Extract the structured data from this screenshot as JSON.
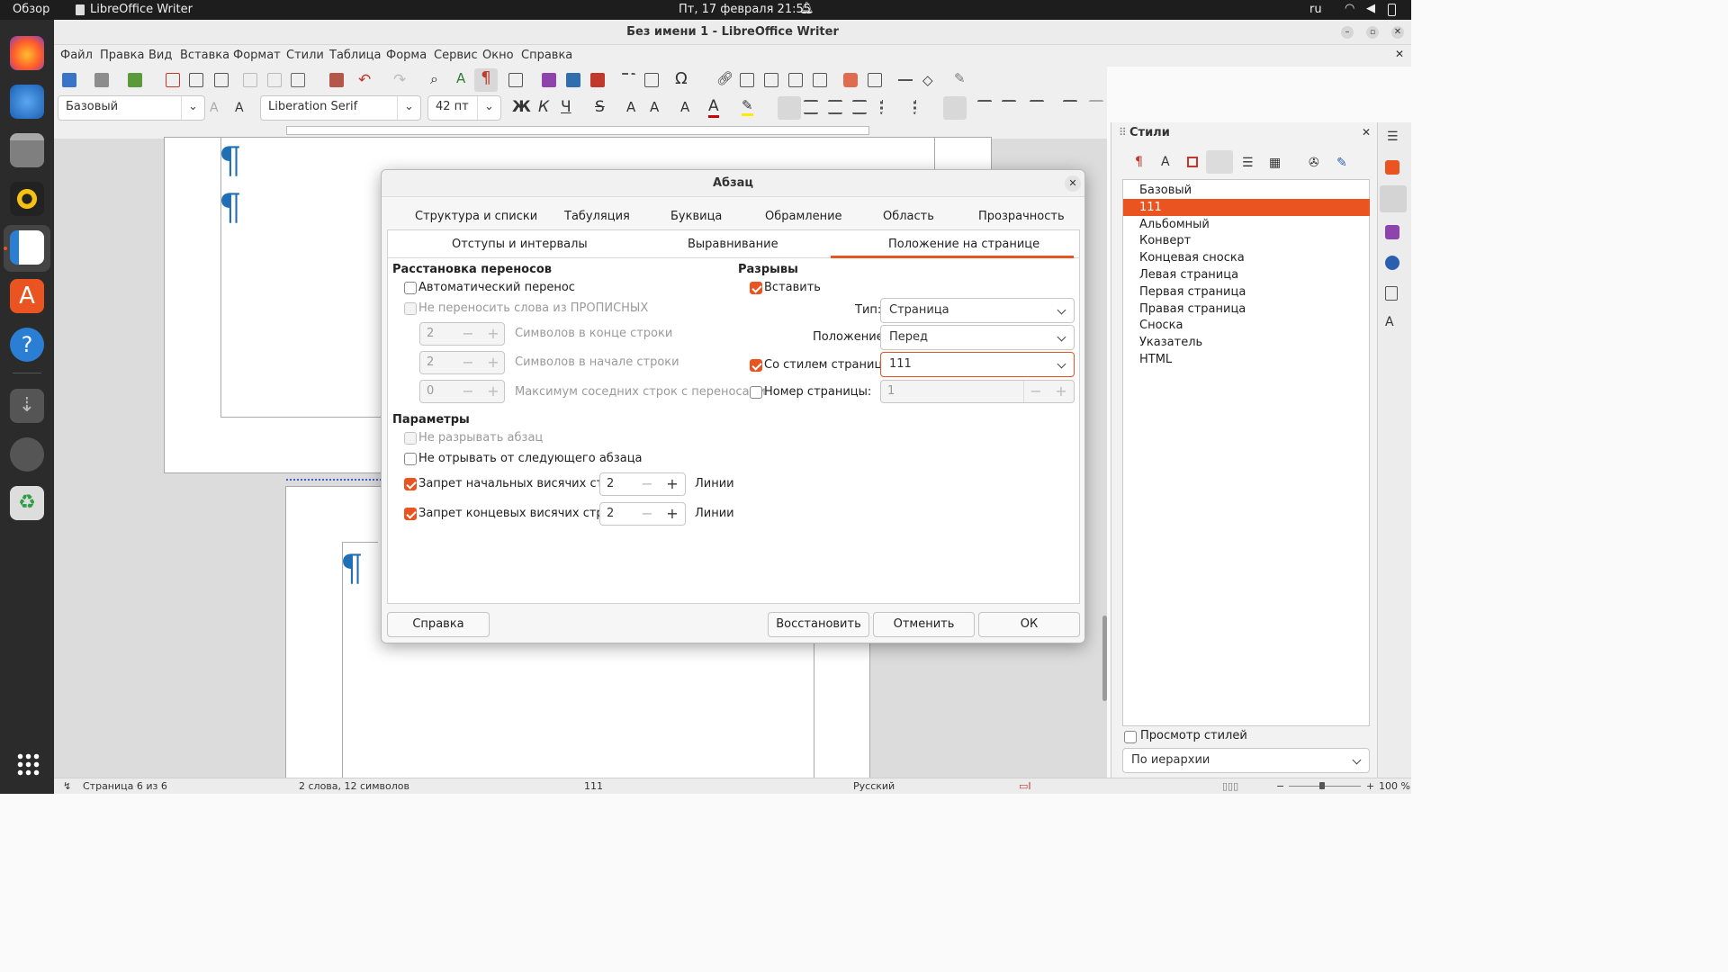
{
  "topbar": {
    "activities": "Обзор",
    "app_name": "LibreOffice Writer",
    "datetime": "Пт, 17 февраля  21:55",
    "lang": "ru"
  },
  "window": {
    "title": "Без имени 1 - LibreOffice Writer"
  },
  "menu": [
    "Файл",
    "Правка",
    "Вид",
    "Вставка",
    "Формат",
    "Стили",
    "Таблица",
    "Форма",
    "Сервис",
    "Окно",
    "Справка"
  ],
  "toolbar": {
    "para_style": "Базовый",
    "font_name": "Liberation Serif",
    "font_size": "42 пт"
  },
  "sidebar": {
    "title": "Стили",
    "styles": [
      "Базовый",
      "111",
      "Альбомный",
      "Конверт",
      "Концевая сноска",
      "Левая страница",
      "Первая страница",
      "Правая страница",
      "Сноска",
      "Указатель",
      "HTML"
    ],
    "selected_index": 1,
    "preview_label": "Просмотр стилей",
    "filter": "По иерархии"
  },
  "status": {
    "page": "Страница 6 из 6",
    "words": "2 слова, 12 символов",
    "style": "111",
    "lang": "Русский",
    "zoom": "100 %"
  },
  "dialog": {
    "title": "Абзац",
    "tabs_row1": [
      "Структура и списки",
      "Табуляция",
      "Буквица",
      "Обрамление",
      "Область",
      "Прозрачность"
    ],
    "tabs_row2": [
      "Отступы и интервалы",
      "Выравнивание",
      "Положение на странице"
    ],
    "active_tab": "Положение на странице",
    "hyph": {
      "title": "Расстановка переносов",
      "auto": "Автоматический перенос",
      "no_caps": "Не переносить слова из ПРОПИСНЫХ",
      "end_chars_val": "2",
      "end_chars_lbl": "Символов в конце строки",
      "start_chars_val": "2",
      "start_chars_lbl": "Символов в начале строки",
      "max_val": "0",
      "max_lbl": "Максимум соседних строк с переносами"
    },
    "params": {
      "title": "Параметры",
      "no_split": "Не разрывать абзац",
      "keep_next": "Не отрывать от следующего абзаца",
      "orphan": "Запрет начальных висячих строк",
      "orphan_val": "2",
      "widow": "Запрет концевых висячих строк",
      "widow_val": "2",
      "lines": "Линии"
    },
    "breaks": {
      "title": "Разрывы",
      "insert": "Вставить",
      "type_lbl": "Тип:",
      "type_val": "Страница",
      "pos_lbl": "Положение:",
      "pos_val": "Перед",
      "with_style": "Со стилем страницы:",
      "style_val": "111",
      "page_num": "Номер страницы:",
      "page_num_val": "1"
    },
    "buttons": {
      "help": "Справка",
      "reset": "Восстановить",
      "cancel": "Отменить",
      "ok": "ОК"
    }
  },
  "colors": {
    "accent": "#e95420",
    "pilcrow": "#1f6fb5"
  }
}
